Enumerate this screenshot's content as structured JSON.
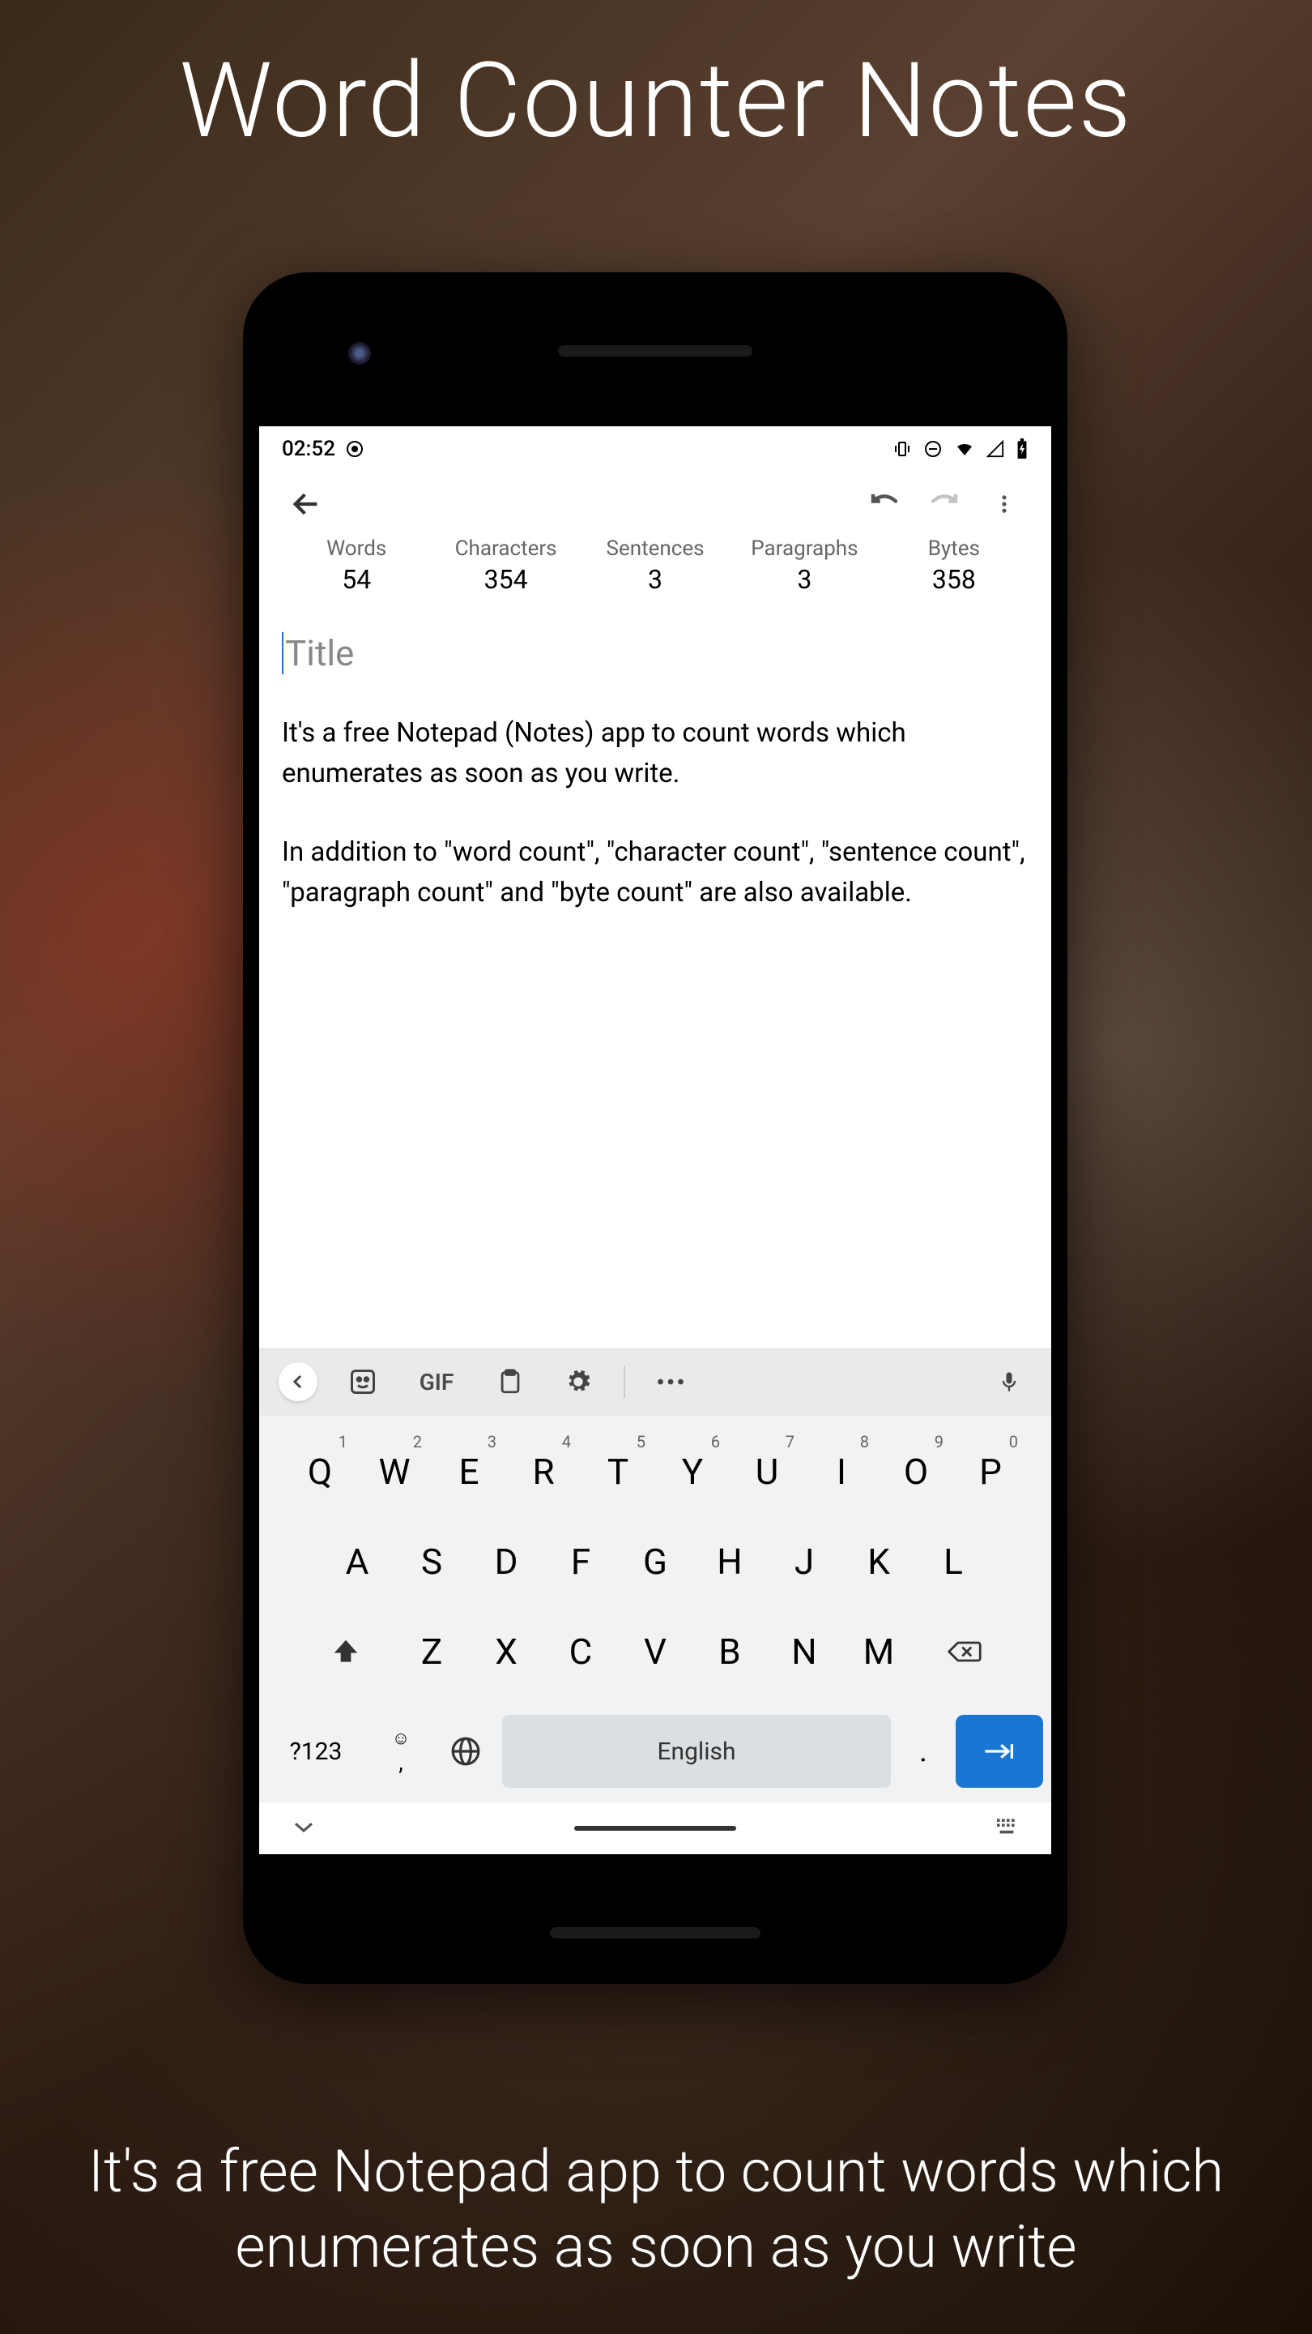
{
  "promo": {
    "title": "Word Counter Notes",
    "footer": "It's a free Notepad app to count words which enumerates as soon as you write"
  },
  "status": {
    "time": "02:52"
  },
  "stats": {
    "words": {
      "label": "Words",
      "value": "54"
    },
    "characters": {
      "label": "Characters",
      "value": "354"
    },
    "sentences": {
      "label": "Sentences",
      "value": "3"
    },
    "paragraphs": {
      "label": "Paragraphs",
      "value": "3"
    },
    "bytes": {
      "label": "Bytes",
      "value": "358"
    }
  },
  "editor": {
    "title_placeholder": "Title",
    "paragraph1": "It's a free Notepad (Notes) app to count words which enumerates as soon as you write.",
    "paragraph2": "In addition to \"word count\", \"character count\", \"sentence count\", \"paragraph count\" and \"byte count\" are also available."
  },
  "keyboard": {
    "strip": {
      "gif": "GIF"
    },
    "row1": [
      {
        "k": "Q",
        "n": "1"
      },
      {
        "k": "W",
        "n": "2"
      },
      {
        "k": "E",
        "n": "3"
      },
      {
        "k": "R",
        "n": "4"
      },
      {
        "k": "T",
        "n": "5"
      },
      {
        "k": "Y",
        "n": "6"
      },
      {
        "k": "U",
        "n": "7"
      },
      {
        "k": "I",
        "n": "8"
      },
      {
        "k": "O",
        "n": "9"
      },
      {
        "k": "P",
        "n": "0"
      }
    ],
    "row2": [
      "A",
      "S",
      "D",
      "F",
      "G",
      "H",
      "J",
      "K",
      "L"
    ],
    "row3": [
      "Z",
      "X",
      "C",
      "V",
      "B",
      "N",
      "M"
    ],
    "mode": "?123",
    "comma": ",",
    "space": "English",
    "period": "."
  }
}
